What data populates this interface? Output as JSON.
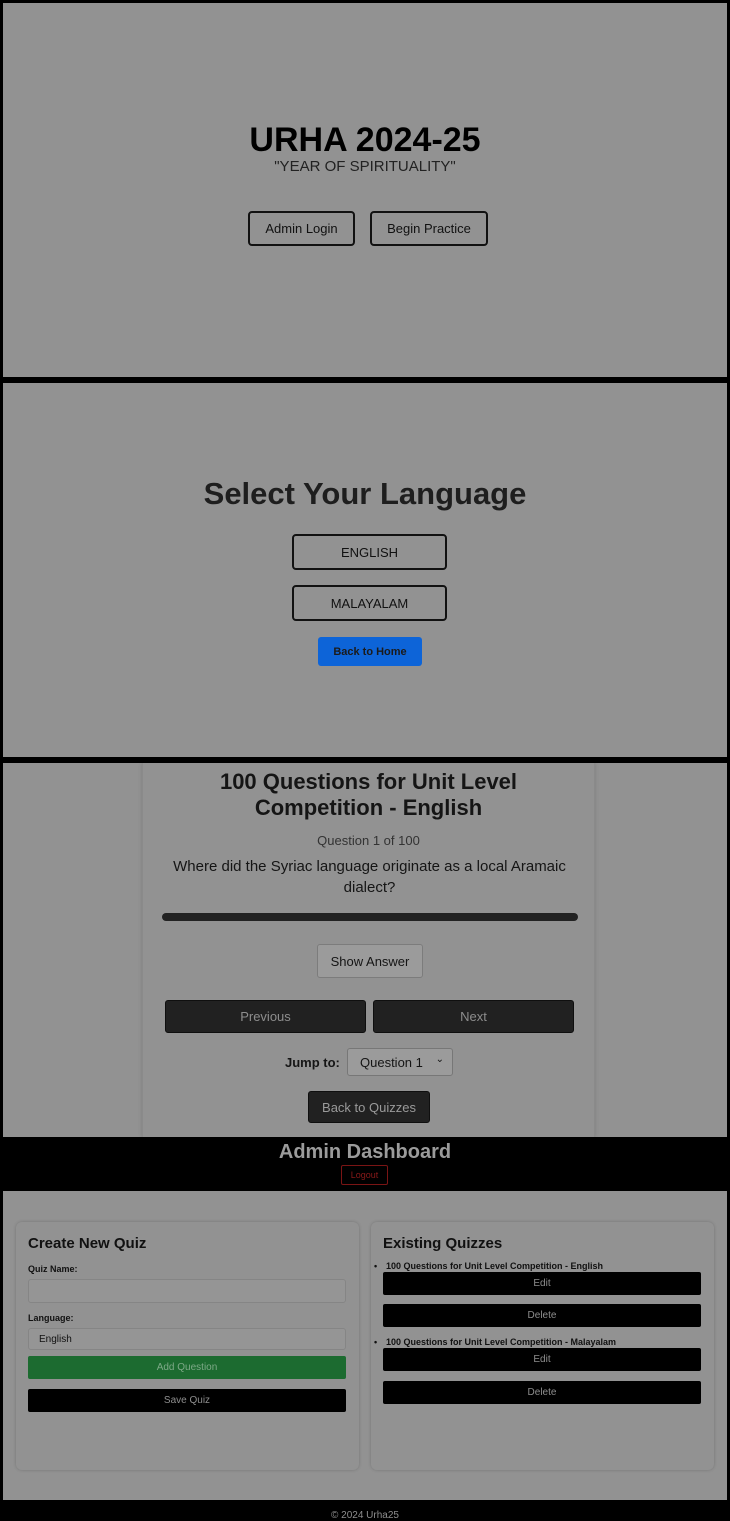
{
  "home": {
    "title": "URHA 2024-25",
    "subtitle": "\"YEAR OF SPIRITUALITY\"",
    "admin_login_label": "Admin Login",
    "begin_practice_label": "Begin Practice"
  },
  "language_select": {
    "title": "Select Your Language",
    "options": [
      "ENGLISH",
      "MALAYALAM"
    ],
    "back_label": "Back to Home"
  },
  "quiz": {
    "title_line1": "100 Questions for Unit Level",
    "title_line2": "Competition - English",
    "question_counter": "Question 1 of 100",
    "question_text": "Where did the Syriac language originate as a local Aramaic dialect?",
    "progress": 0.01,
    "show_answer_label": "Show Answer",
    "previous_label": "Previous",
    "next_label": "Next",
    "jump_label": "Jump to:",
    "jump_selected": "Question 1",
    "back_label": "Back to Quizzes"
  },
  "admin": {
    "title": "Admin Dashboard",
    "logout_label": "Logout",
    "create": {
      "title": "Create New Quiz",
      "quiz_name_label": "Quiz Name:",
      "quiz_name_value": "",
      "language_label": "Language:",
      "language_selected": "English",
      "add_question_label": "Add Question",
      "save_quiz_label": "Save Quiz"
    },
    "existing": {
      "title": "Existing Quizzes",
      "quizzes": [
        {
          "name": "100 Questions for Unit Level Competition - English",
          "edit_label": "Edit",
          "delete_label": "Delete"
        },
        {
          "name": "100 Questions for Unit Level Competition - Malayalam",
          "edit_label": "Edit",
          "delete_label": "Delete"
        }
      ]
    }
  },
  "footer": {
    "text": "© 2024 Urha25"
  },
  "colors": {
    "panel_bg": "#929292",
    "blue_accent": "#0d64d8",
    "green_accent": "#1c6b30",
    "logout_red": "#7a1414"
  }
}
